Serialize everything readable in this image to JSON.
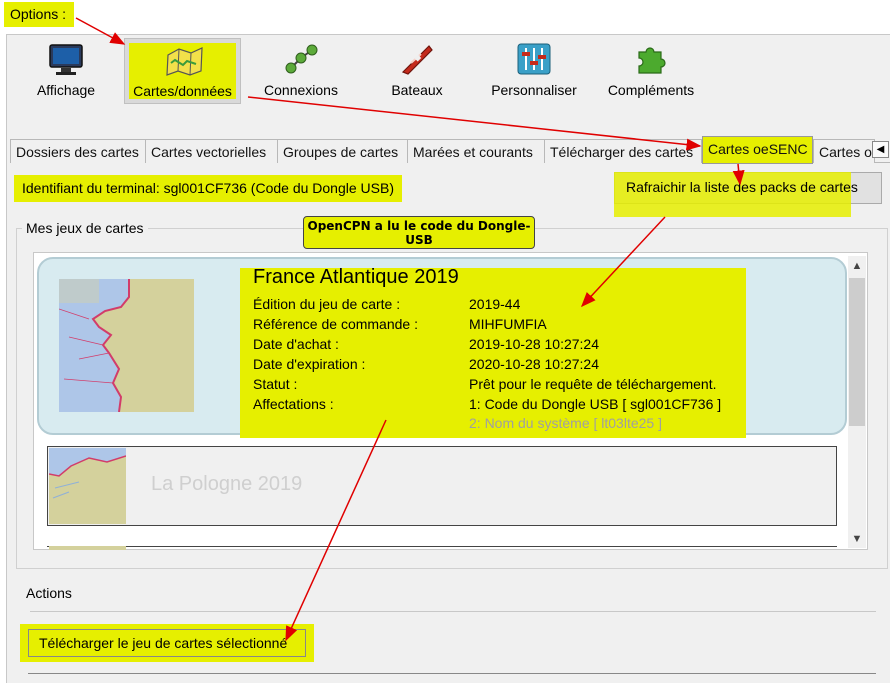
{
  "annotation": {
    "options_label": "Options :",
    "callout_text": "OpenCPN a lu le code du Dongle-USB",
    "accent_color": "#e6ef00",
    "arrow_color": "#e00000"
  },
  "toolbar": {
    "items": [
      {
        "label": "Affichage",
        "icon": "display-monitor-icon"
      },
      {
        "label": "Cartes/données",
        "icon": "charts-folder-icon"
      },
      {
        "label": "Connexions",
        "icon": "connections-icon"
      },
      {
        "label": "Bateaux",
        "icon": "boat-icon"
      },
      {
        "label": "Personnaliser",
        "icon": "sliders-icon"
      },
      {
        "label": "Compléments",
        "icon": "puzzle-icon"
      }
    ],
    "selected": "Cartes/données"
  },
  "tabs": {
    "items": [
      "Dossiers des cartes",
      "Cartes vectorielles",
      "Groupes de cartes",
      "Marées et courants",
      "Télécharger des cartes",
      "Cartes oeSENC",
      "Cartes o"
    ],
    "active": "Cartes oeSENC",
    "scroll_arrow": "◀"
  },
  "oesenc": {
    "device_id_text": "Identifiant du terminal: sgl001CF736 (Code du Dongle USB)",
    "refresh_button": "Rafraichir la liste des packs de cartes",
    "group_title": "Mes jeux de cartes",
    "charts": [
      {
        "title": "France Atlantique 2019",
        "fields": [
          {
            "key": "Édition du jeu de carte :",
            "value": "2019-44"
          },
          {
            "key": "Référence de commande :",
            "value": "MIHFUMFIA"
          },
          {
            "key": "Date d'achat :",
            "value": "2019-10-28 10:27:24"
          },
          {
            "key": "Date d'expiration :",
            "value": "2020-10-28 10:27:24"
          },
          {
            "key": "Statut :",
            "value": "Prêt pour le requête de téléchargement."
          },
          {
            "key": "Affectations :",
            "value": "1: Code du Dongle USB  [ sgl001CF736 ]"
          },
          {
            "key": "",
            "value": "2: Nom du système  [ lt03lte25 ]"
          }
        ]
      },
      {
        "title": "La Pologne 2019"
      }
    ],
    "actions_title": "Actions",
    "download_button": "Télécharger le jeu de cartes sélectionné"
  }
}
